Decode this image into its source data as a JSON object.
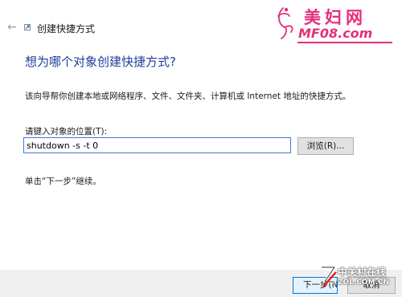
{
  "window": {
    "title": "创建快捷方式"
  },
  "watermark": {
    "brand_cn": "美妇网",
    "brand_en": "MF08.com",
    "zol_cn": "中关村在线",
    "zol_en": "ZOL.COM.CN"
  },
  "main": {
    "heading": "想为哪个对象创建快捷方式?",
    "description": "该向导帮你创建本地或网络程序、文件、文件夹、计算机或 Internet 地址的快捷方式。",
    "location_label": "请键入对象的位置(T):",
    "location_value": "shutdown -s -t 0",
    "browse_label": "浏览(R)...",
    "continue_text": "单击“下一步”继续。"
  },
  "footer": {
    "next_label": "下一步(N)",
    "cancel_label": "取消"
  },
  "colors": {
    "heading": "#1e3e9c",
    "input_border": "#3d7bd6",
    "watermark_pink": "#e52f7c",
    "button_bg": "#e1e1e1"
  },
  "icons": {
    "back": "back-arrow-icon",
    "title": "shortcut-icon"
  }
}
